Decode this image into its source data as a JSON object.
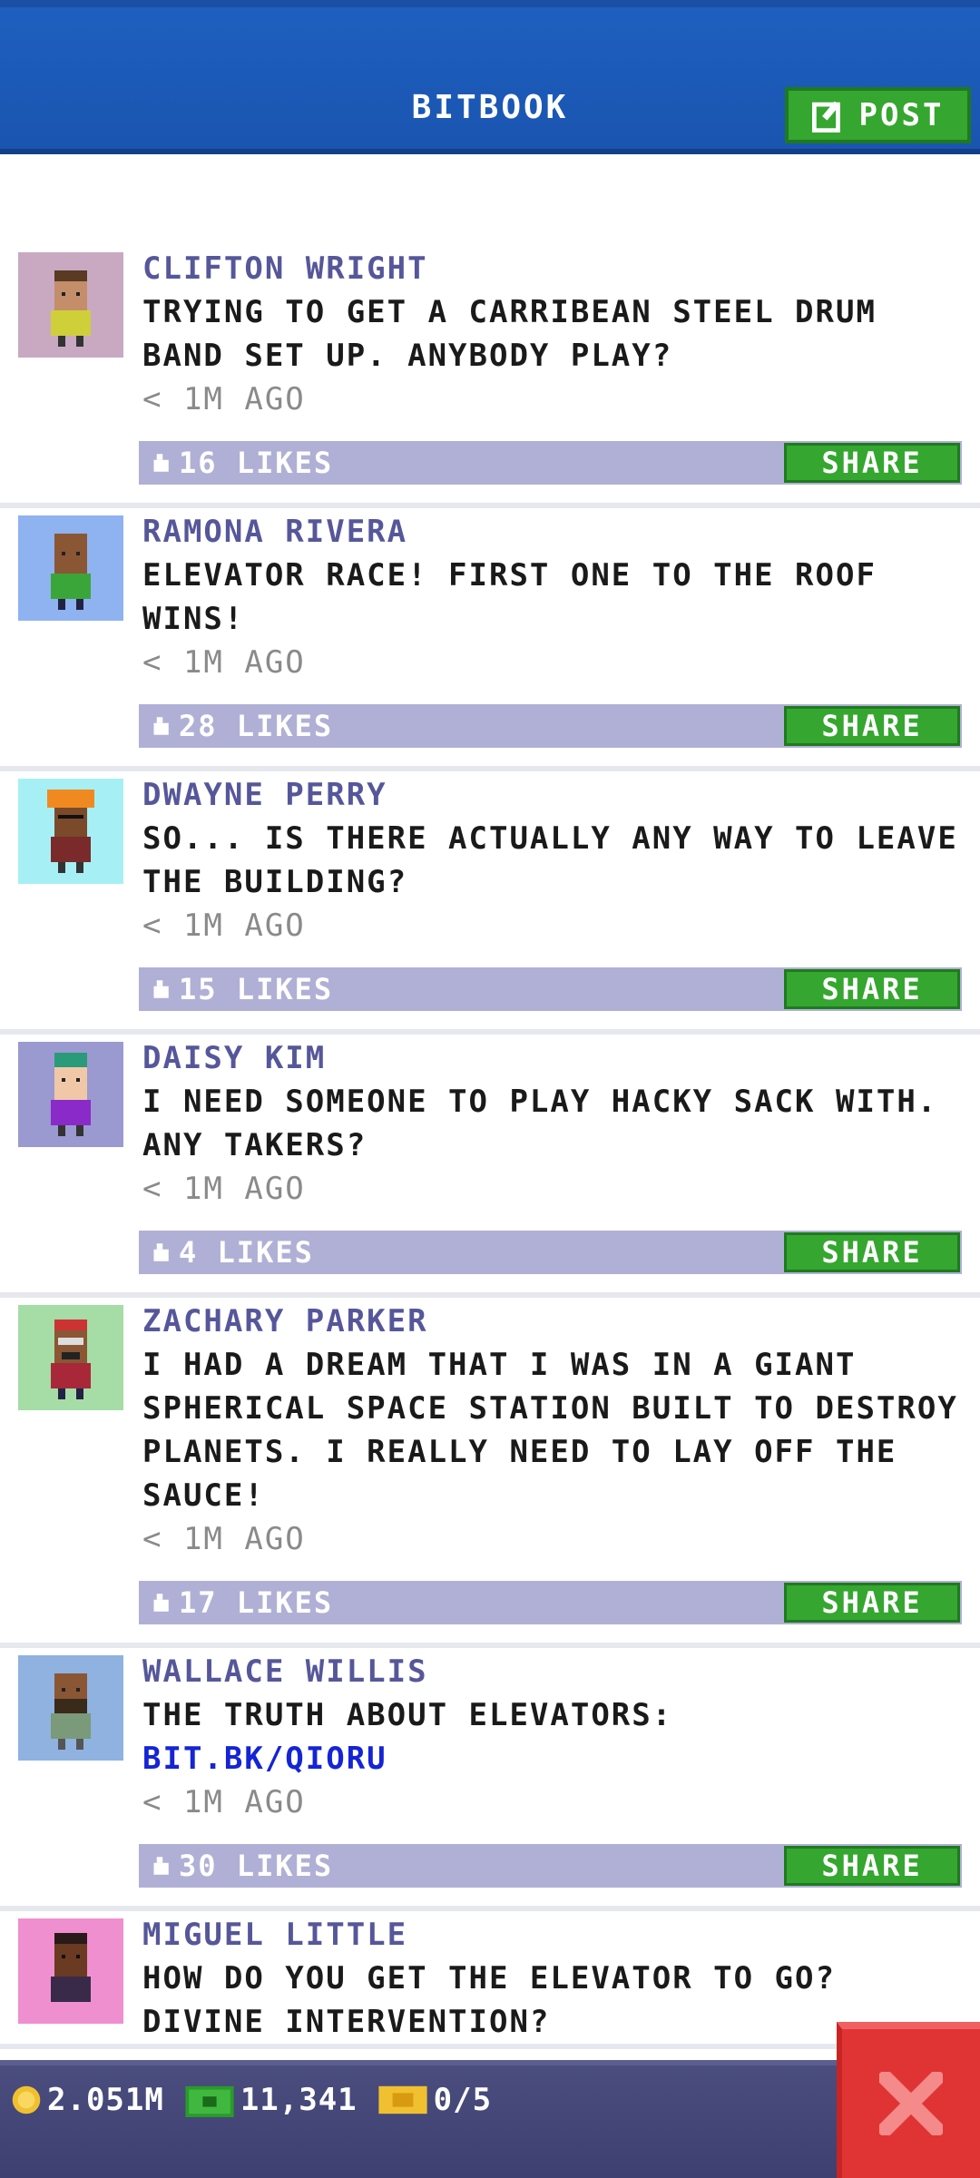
{
  "header": {
    "title": "BITBOOK",
    "post_label": "POST"
  },
  "posts": [
    {
      "author": "CLIFTON WRIGHT",
      "message": "TRYING TO GET A CARRIBEAN STEEL DRUM BAND SET UP. ANYBODY PLAY?",
      "time": "< 1M AGO",
      "likes": "16 LIKES",
      "share": "SHARE",
      "avatar_bg": "#c9a9c2"
    },
    {
      "author": "RAMONA RIVERA",
      "message": "ELEVATOR RACE! FIRST ONE TO THE ROOF WINS!",
      "time": "< 1M AGO",
      "likes": "28 LIKES",
      "share": "SHARE",
      "avatar_bg": "#8fb2f0"
    },
    {
      "author": "DWAYNE PERRY",
      "message": "SO... IS THERE ACTUALLY ANY WAY TO LEAVE THE BUILDING?",
      "time": "< 1M AGO",
      "likes": "15 LIKES",
      "share": "SHARE",
      "avatar_bg": "#a6f0f5"
    },
    {
      "author": "DAISY KIM",
      "message": "I NEED SOMEONE TO PLAY HACKY SACK WITH. ANY TAKERS?",
      "time": "< 1M AGO",
      "likes": "4 LIKES",
      "share": "SHARE",
      "avatar_bg": "#9a9ad0"
    },
    {
      "author": "ZACHARY PARKER",
      "message": "I HAD A DREAM THAT I WAS IN A GIANT SPHERICAL SPACE STATION BUILT TO DESTROY PLANETS. I REALLY NEED TO LAY OFF THE SAUCE!",
      "time": "< 1M AGO",
      "likes": "17 LIKES",
      "share": "SHARE",
      "avatar_bg": "#a6dca6"
    },
    {
      "author": "WALLACE WILLIS",
      "message": "THE TRUTH ABOUT ELEVATORS:",
      "link": "BIT.BK/QIORU",
      "time": "< 1M AGO",
      "likes": "30 LIKES",
      "share": "SHARE",
      "avatar_bg": "#8fb2e0"
    },
    {
      "author": "MIGUEL LITTLE",
      "message": "HOW DO YOU GET THE ELEVATOR TO GO? DIVINE INTERVENTION?",
      "avatar_bg": "#f08fd0"
    }
  ],
  "bottom_bar": {
    "coins": "2.051M",
    "bux": "11,341",
    "tickets": "0/5"
  },
  "colors": {
    "header_blue": "#1e5fbf",
    "button_green": "#35a62f",
    "like_bar": "#b0b0d6",
    "author": "#56579a",
    "link": "#1424d6",
    "close_red": "#e03434"
  }
}
